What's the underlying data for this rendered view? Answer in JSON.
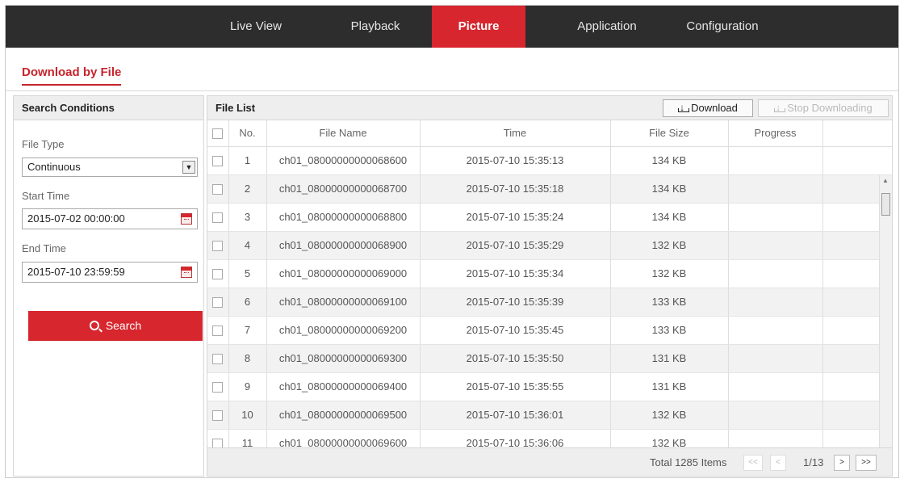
{
  "nav": {
    "items": [
      {
        "label": "Live View",
        "active": false
      },
      {
        "label": "Playback",
        "active": false
      },
      {
        "label": "Picture",
        "active": true
      },
      {
        "label": "Application",
        "active": false
      },
      {
        "label": "Configuration",
        "active": false
      }
    ]
  },
  "page_tab": "Download by File",
  "search": {
    "header": "Search Conditions",
    "file_type_label": "File Type",
    "file_type_value": "Continuous",
    "start_time_label": "Start Time",
    "start_time_value": "2015-07-02 00:00:00",
    "end_time_label": "End Time",
    "end_time_value": "2015-07-10 23:59:59",
    "search_button": "Search"
  },
  "file_list": {
    "header": "File List",
    "download_button": "Download",
    "stop_button": "Stop Downloading",
    "columns": [
      "No.",
      "File Name",
      "Time",
      "File Size",
      "Progress"
    ],
    "rows": [
      {
        "no": "1",
        "name": "ch01_08000000000068600",
        "time": "2015-07-10 15:35:13",
        "size": "134 KB",
        "progress": ""
      },
      {
        "no": "2",
        "name": "ch01_08000000000068700",
        "time": "2015-07-10 15:35:18",
        "size": "134 KB",
        "progress": ""
      },
      {
        "no": "3",
        "name": "ch01_08000000000068800",
        "time": "2015-07-10 15:35:24",
        "size": "134 KB",
        "progress": ""
      },
      {
        "no": "4",
        "name": "ch01_08000000000068900",
        "time": "2015-07-10 15:35:29",
        "size": "132 KB",
        "progress": ""
      },
      {
        "no": "5",
        "name": "ch01_08000000000069000",
        "time": "2015-07-10 15:35:34",
        "size": "132 KB",
        "progress": ""
      },
      {
        "no": "6",
        "name": "ch01_08000000000069100",
        "time": "2015-07-10 15:35:39",
        "size": "133 KB",
        "progress": ""
      },
      {
        "no": "7",
        "name": "ch01_08000000000069200",
        "time": "2015-07-10 15:35:45",
        "size": "133 KB",
        "progress": ""
      },
      {
        "no": "8",
        "name": "ch01_08000000000069300",
        "time": "2015-07-10 15:35:50",
        "size": "131 KB",
        "progress": ""
      },
      {
        "no": "9",
        "name": "ch01_08000000000069400",
        "time": "2015-07-10 15:35:55",
        "size": "131 KB",
        "progress": ""
      },
      {
        "no": "10",
        "name": "ch01_08000000000069500",
        "time": "2015-07-10 15:36:01",
        "size": "132 KB",
        "progress": ""
      },
      {
        "no": "11",
        "name": "ch01_08000000000069600",
        "time": "2015-07-10 15:36:06",
        "size": "132 KB",
        "progress": ""
      }
    ]
  },
  "pagination": {
    "total_text": "Total 1285 Items",
    "first": "<<",
    "prev": "<",
    "page": "1/13",
    "next": ">",
    "last": ">>"
  },
  "colors": {
    "accent": "#d7262e",
    "nav_bg": "#2d2d2d"
  }
}
